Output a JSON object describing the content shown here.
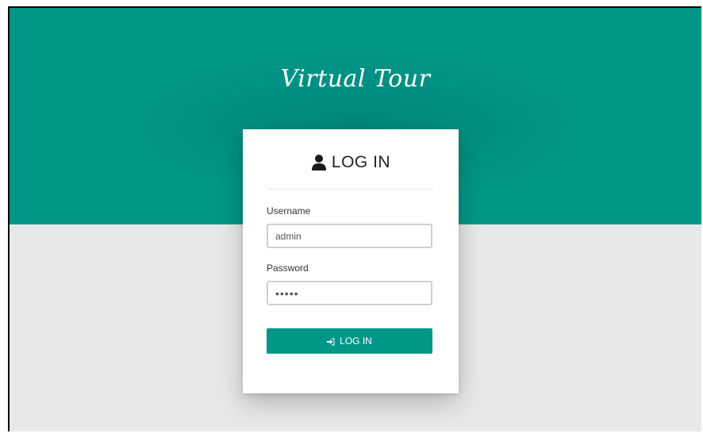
{
  "app": {
    "title": "Virtual Tour"
  },
  "login": {
    "heading": "LOG IN",
    "heading_icon": "user-icon",
    "username": {
      "label": "Username",
      "value": "admin"
    },
    "password": {
      "label": "Password",
      "value": "•••••"
    },
    "submit_label": "LOG IN",
    "submit_icon": "sign-in-icon"
  },
  "colors": {
    "primary": "#009688",
    "background": "#e8e8e8",
    "card": "#ffffff"
  }
}
